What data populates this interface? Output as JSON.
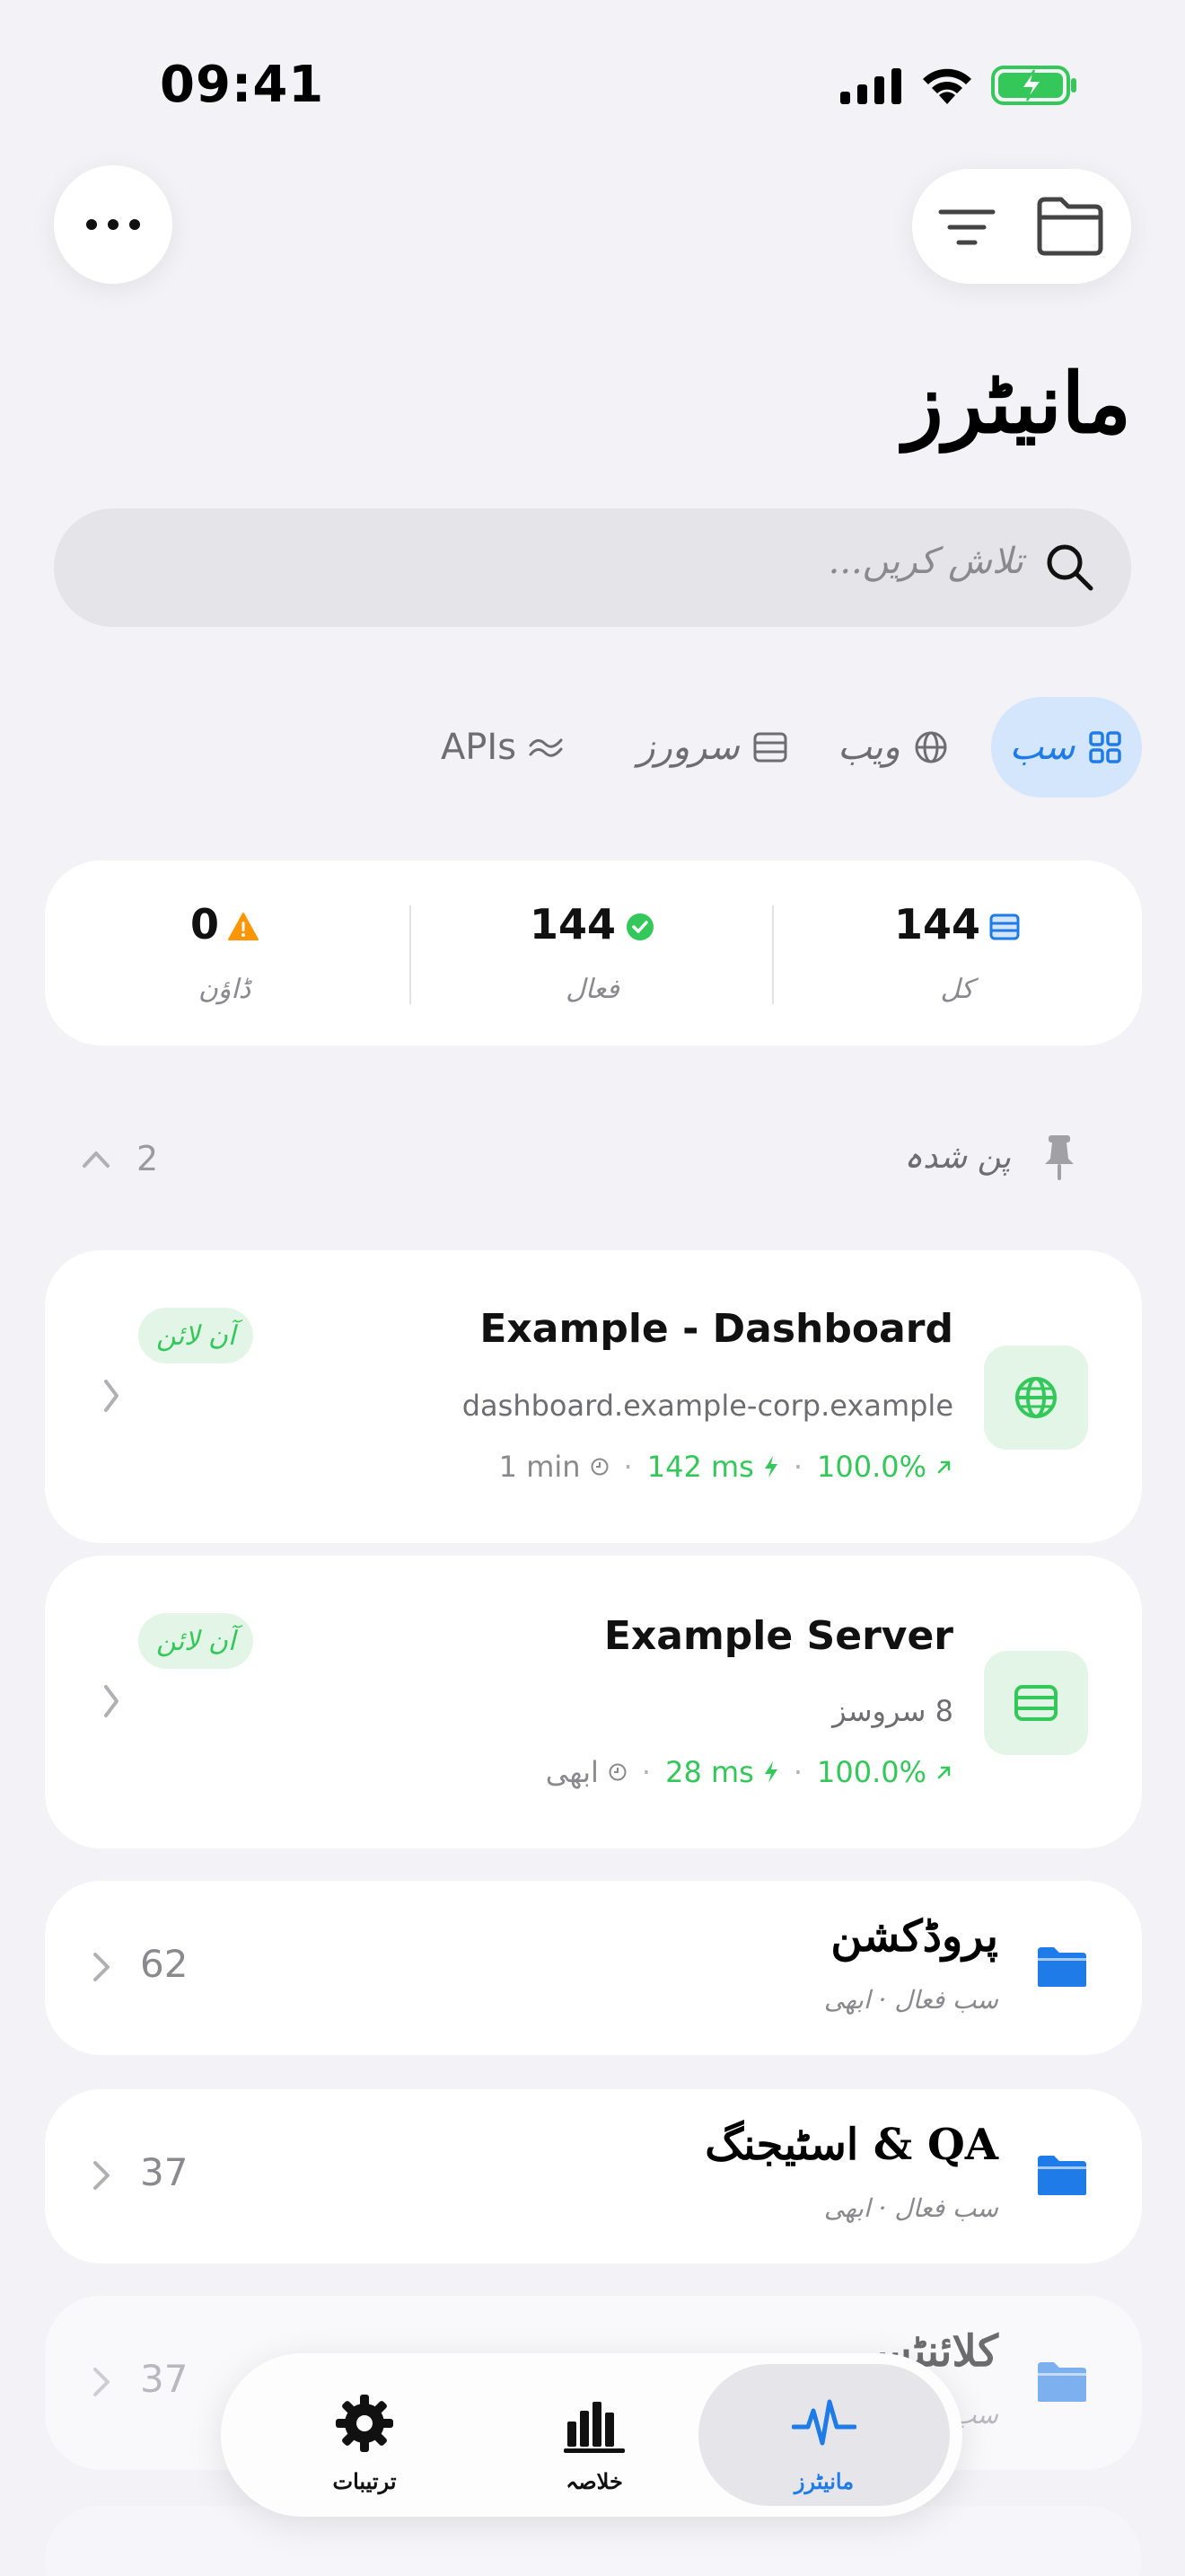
{
  "status_bar": {
    "time": "09:41"
  },
  "header": {
    "more_icon": "ellipsis-icon",
    "sort_icon": "sort-lines-icon",
    "folder_icon": "folder-icon",
    "title": "مانیٹرز"
  },
  "search": {
    "placeholder": "تلاش کریں..."
  },
  "filters": [
    {
      "label": "سب",
      "icon": "grid-icon",
      "active": true
    },
    {
      "label": "ویب",
      "icon": "globe-icon",
      "active": false
    },
    {
      "label": "سرورز",
      "icon": "server-icon",
      "active": false
    },
    {
      "label": "APIs",
      "icon": "api-wave-icon",
      "active": false
    }
  ],
  "stats": {
    "total": {
      "value": "144",
      "label": "کل"
    },
    "active": {
      "value": "144",
      "label": "فعال"
    },
    "down": {
      "value": "0",
      "label": "ڈاؤن"
    }
  },
  "pinned": {
    "label": "پن شدہ",
    "count": "2"
  },
  "monitors": [
    {
      "name": "Example - Dashboard",
      "subtitle": "dashboard.example-corp.example",
      "interval": "1 min",
      "latency": "142 ms",
      "uptime": "100.0%",
      "status": "آن لائن",
      "icon": "globe-icon"
    },
    {
      "name": "Example Server",
      "subtitle": "8 سروسز",
      "interval": "ابھی",
      "latency": "28 ms",
      "uptime": "100.0%",
      "status": "آن لائن",
      "icon": "server-icon"
    }
  ],
  "folders": [
    {
      "name": "پروڈکشن",
      "summary": "سب فعال · ابھی",
      "count": "62"
    },
    {
      "name": "QA & اسٹیجنگ",
      "summary": "سب فعال · ابھی",
      "count": "37"
    },
    {
      "name": "کلائنٹس",
      "summary": "سب فعال · ابھی",
      "count": "37"
    }
  ],
  "tabbar": [
    {
      "label": "ترتیبات",
      "icon": "gear-icon",
      "active": false
    },
    {
      "label": "خلاصہ",
      "icon": "bar-chart-icon",
      "active": false
    },
    {
      "label": "مانیٹرز",
      "icon": "pulse-icon",
      "active": true
    }
  ],
  "colors": {
    "accent": "#1f7be8",
    "success": "#34c759",
    "warning": "#ff9500",
    "background": "#f2f2f7"
  }
}
